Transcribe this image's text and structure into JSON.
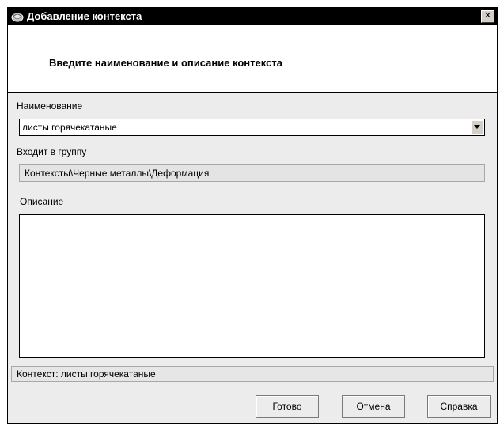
{
  "window": {
    "title": "Добавление контекста",
    "close_label": "✕",
    "title_icon": "context-app-icon"
  },
  "header": {
    "instruction": "Введите наименование и описание контекста"
  },
  "form": {
    "name_label": "Наименование",
    "name_value": "листы горячекатаные",
    "group_label": "Входит в группу",
    "group_value": "Контексты\\Черные металлы\\Деформация",
    "description_label": "Описание",
    "description_value": ""
  },
  "status": {
    "text": "Контекст: листы горячекатаные"
  },
  "buttons": {
    "ok": "Готово",
    "cancel": "Отмена",
    "help": "Справка"
  }
}
